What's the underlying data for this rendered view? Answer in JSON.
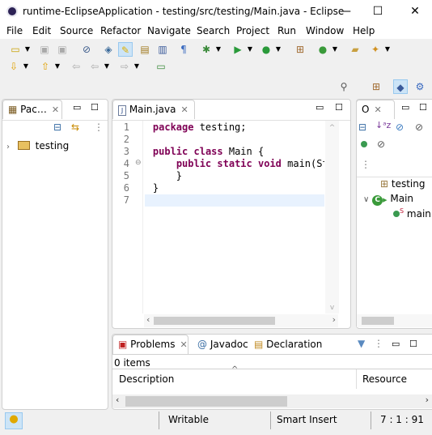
{
  "window": {
    "title": "runtime-EclipseApplication - testing/src/testing/Main.java - Eclipse",
    "minimize": "—",
    "maximize": "☐",
    "close": "✕"
  },
  "menu": [
    "File",
    "Edit",
    "Source",
    "Refactor",
    "Navigate",
    "Search",
    "Project",
    "Run",
    "Window",
    "Help"
  ],
  "package_explorer": {
    "tab": "Pac…",
    "tree": [
      {
        "label": "testing"
      }
    ]
  },
  "editor": {
    "tab": "Main.java",
    "lines": [
      {
        "n": "1",
        "code": [
          {
            "k": true,
            "t": "package"
          },
          {
            "t": " testing;"
          }
        ]
      },
      {
        "n": "2",
        "code": []
      },
      {
        "n": "3",
        "code": [
          {
            "k": true,
            "t": "public"
          },
          {
            "t": " "
          },
          {
            "k": true,
            "t": "class"
          },
          {
            "t": " Main {"
          }
        ]
      },
      {
        "n": "4",
        "code": [
          {
            "t": "    "
          },
          {
            "k": true,
            "t": "public"
          },
          {
            "t": " "
          },
          {
            "k": true,
            "t": "static"
          },
          {
            "t": " "
          },
          {
            "k": true,
            "t": "void"
          },
          {
            "t": " main(Stri"
          }
        ]
      },
      {
        "n": "5",
        "code": [
          {
            "t": "    }"
          }
        ]
      },
      {
        "n": "6",
        "code": [
          {
            "t": "}"
          }
        ]
      },
      {
        "n": "7",
        "code": []
      }
    ],
    "current_line": 7
  },
  "outline": {
    "tab": "O",
    "items": [
      {
        "label": "testing",
        "icon": "package-declaration-icon"
      },
      {
        "label": "Main",
        "icon": "class-icon"
      },
      {
        "label": "main",
        "icon": "method-icon",
        "modifier": "S"
      }
    ]
  },
  "problems": {
    "tabs": [
      "Problems",
      "Javadoc",
      "Declaration"
    ],
    "count": "0 items",
    "columns": [
      "Description",
      "Resource"
    ]
  },
  "status": {
    "writable": "Writable",
    "insert_mode": "Smart Insert",
    "position": "7 : 1 : 91"
  }
}
